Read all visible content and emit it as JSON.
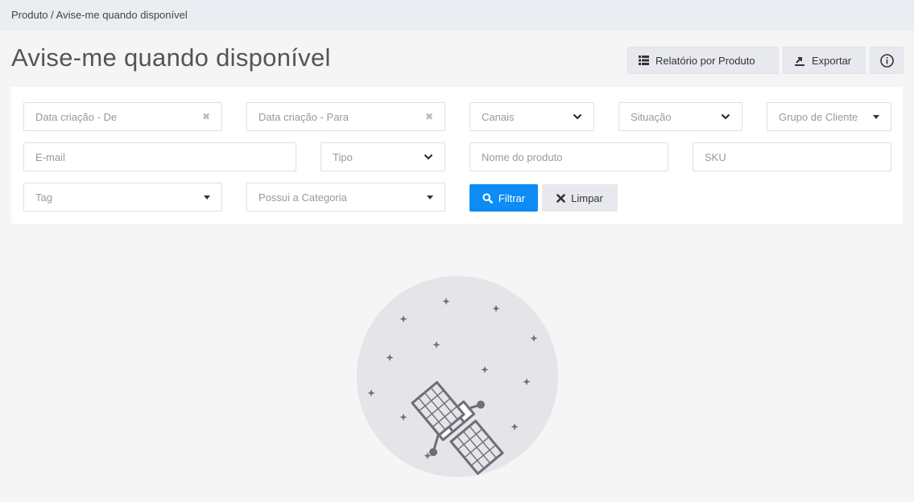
{
  "breadcrumb": "Produto / Avise-me quando disponível",
  "title": "Avise-me quando disponível",
  "toolbar": {
    "report_label": "Relatório por Produto",
    "export_label": "Exportar"
  },
  "filters": {
    "date_from": "Data criação - De",
    "date_to": "Data criação - Para",
    "channels": "Canais",
    "status": "Situação",
    "customer_group": "Grupo de Cliente",
    "email": "E-mail",
    "type": "Tipo",
    "product_name": "Nome do produto",
    "sku": "SKU",
    "tag": "Tag",
    "category": "Possui a Categoria",
    "clear_symbol": "✖"
  },
  "actions": {
    "filter_label": "Filtrar",
    "clear_label": "Limpar"
  },
  "colors": {
    "primary": "#0d8cf5",
    "header_bg": "#eaedf2",
    "page_bg": "#f5f5f5",
    "illustration_bg": "#e4e4e9",
    "illustration_stroke": "#6e6e78"
  },
  "icons": {
    "report": "list-icon",
    "export": "export-icon",
    "info": "info-icon",
    "filter": "search-icon",
    "clear": "close-icon",
    "empty_state": "satellite-icon"
  }
}
